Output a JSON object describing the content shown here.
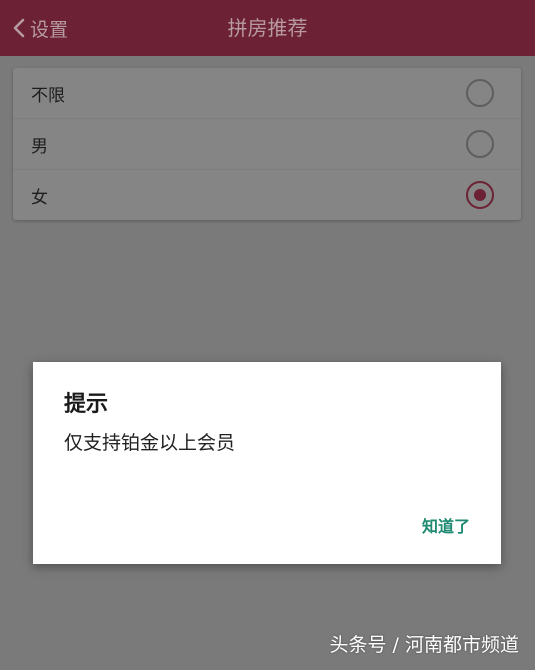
{
  "header": {
    "back_label": "设置",
    "title": "拼房推荐"
  },
  "options": [
    {
      "label": "不限",
      "selected": false
    },
    {
      "label": "男",
      "selected": false
    },
    {
      "label": "女",
      "selected": true
    }
  ],
  "dialog": {
    "title": "提示",
    "message": "仅支持铂金以上会员",
    "button": "知道了"
  },
  "watermark": "头条号 / 河南都市频道",
  "colors": {
    "header_bg": "#6c2134",
    "accent": "#6c2134",
    "dialog_button": "#1e8a72"
  }
}
